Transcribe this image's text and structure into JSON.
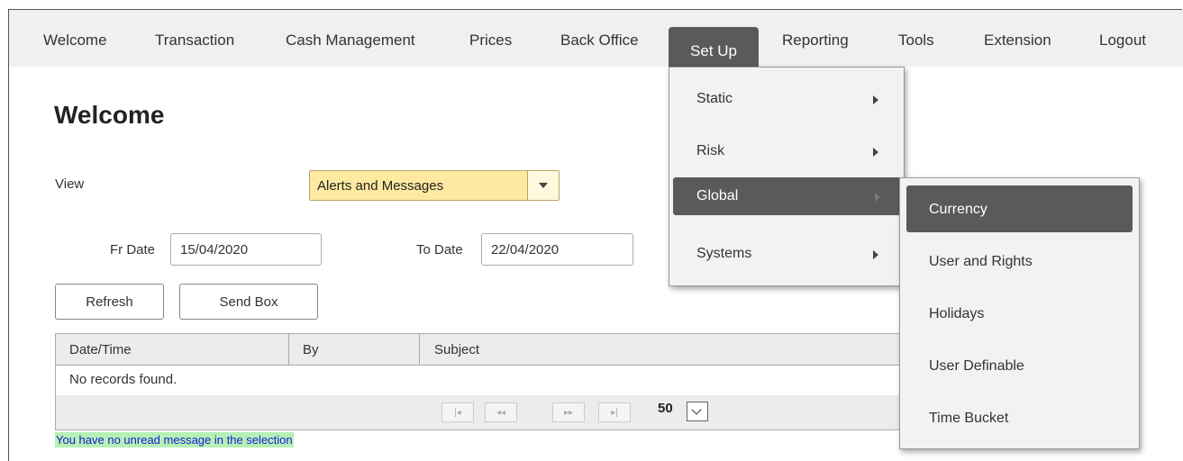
{
  "menubar": {
    "items": [
      {
        "label": "Welcome"
      },
      {
        "label": "Transaction"
      },
      {
        "label": "Cash Management"
      },
      {
        "label": "Prices"
      },
      {
        "label": "Back Office"
      },
      {
        "label": "Set Up"
      },
      {
        "label": "Reporting"
      },
      {
        "label": "Tools"
      },
      {
        "label": "Extension"
      },
      {
        "label": "Logout"
      }
    ],
    "active": "Set Up"
  },
  "page": {
    "title": "Welcome",
    "view_label": "View",
    "view_value": "Alerts and Messages",
    "from_label": "Fr Date",
    "from_value": "15/04/2020",
    "to_label": "To Date",
    "to_value": "22/04/2020",
    "refresh_label": "Refresh",
    "sendbox_label": "Send Box"
  },
  "table": {
    "columns": [
      "Date/Time",
      "By",
      "Subject"
    ],
    "empty_text": "No records found.",
    "pager": {
      "first": "|◂",
      "prev": "◂◂",
      "next": "▸▸",
      "last": "▸|",
      "page_size": "50"
    }
  },
  "status_message": "You have no unread message in the selection",
  "setup_menu": {
    "items": [
      {
        "label": "Static"
      },
      {
        "label": "Risk"
      },
      {
        "label": "Global"
      },
      {
        "label": "Systems"
      }
    ],
    "highlighted": "Global"
  },
  "global_submenu": {
    "items": [
      {
        "label": "Currency"
      },
      {
        "label": "User and Rights"
      },
      {
        "label": "Holidays"
      },
      {
        "label": "User Definable"
      },
      {
        "label": "Time Bucket"
      }
    ],
    "highlighted": "Currency"
  },
  "colors": {
    "menu_active": "#5a5a5a",
    "select_bg": "#fde9a0",
    "status_text": "#1a1ad6",
    "status_bg": "#b5f0b5"
  }
}
